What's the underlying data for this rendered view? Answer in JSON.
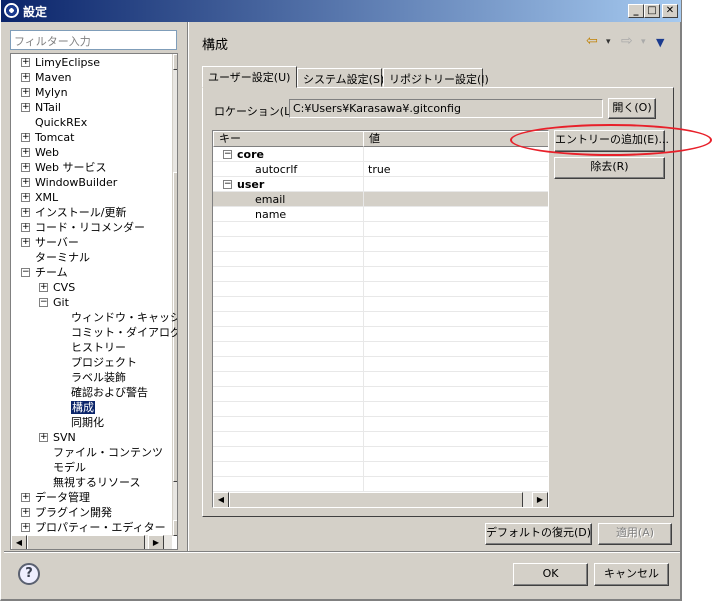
{
  "window": {
    "title": "設定"
  },
  "filter": {
    "placeholder": "フィルター入力"
  },
  "tree": {
    "items": [
      {
        "label": "LimyEclipse",
        "exp": "+"
      },
      {
        "label": "Maven",
        "exp": "+"
      },
      {
        "label": "Mylyn",
        "exp": "+"
      },
      {
        "label": "NTail",
        "exp": "+"
      },
      {
        "label": "QuickREx",
        "exp": ""
      },
      {
        "label": "Tomcat",
        "exp": "+"
      },
      {
        "label": "Web",
        "exp": "+"
      },
      {
        "label": "Web サービス",
        "exp": "+"
      },
      {
        "label": "WindowBuilder",
        "exp": "+"
      },
      {
        "label": "XML",
        "exp": "+"
      },
      {
        "label": "インストール/更新",
        "exp": "+"
      },
      {
        "label": "コード・リコメンダー",
        "exp": "+"
      },
      {
        "label": "サーバー",
        "exp": "+"
      },
      {
        "label": "ターミナル",
        "exp": ""
      },
      {
        "label": "チーム",
        "exp": "−"
      },
      {
        "label": "CVS",
        "exp": "+"
      },
      {
        "label": "Git",
        "exp": "−"
      },
      {
        "label": "ウィンドウ・キャッシュ",
        "exp": ""
      },
      {
        "label": "コミット・ダイアログ",
        "exp": ""
      },
      {
        "label": "ヒストリー",
        "exp": ""
      },
      {
        "label": "プロジェクト",
        "exp": ""
      },
      {
        "label": "ラベル装飾",
        "exp": ""
      },
      {
        "label": "確認および警告",
        "exp": ""
      },
      {
        "label": "構成",
        "exp": ""
      },
      {
        "label": "同期化",
        "exp": ""
      },
      {
        "label": "SVN",
        "exp": "+"
      },
      {
        "label": "ファイル・コンテンツ",
        "exp": ""
      },
      {
        "label": "モデル",
        "exp": ""
      },
      {
        "label": "無視するリソース",
        "exp": ""
      },
      {
        "label": "データ管理",
        "exp": "+"
      },
      {
        "label": "プラグイン開発",
        "exp": "+"
      },
      {
        "label": "プロパティー・エディター",
        "exp": "+"
      }
    ]
  },
  "page": {
    "title": "構成"
  },
  "tabs": [
    "ユーザー設定(U)",
    "システム設定(S)",
    "リポジトリー設定(I)"
  ],
  "location": {
    "label": "ロケーション(L):",
    "value": "C:¥Users¥Karasawa¥.gitconfig",
    "open_button": "開く(O)"
  },
  "table": {
    "headers": [
      "キー",
      "値"
    ],
    "rows": [
      {
        "key": "core",
        "value": "",
        "section": true
      },
      {
        "key": "autocrlf",
        "value": "true",
        "section": false
      },
      {
        "key": "user",
        "value": "",
        "section": true
      },
      {
        "key": "email",
        "value": "",
        "section": false
      },
      {
        "key": "name",
        "value": "",
        "section": false
      }
    ]
  },
  "buttons": {
    "add_entry": "エントリーの追加(E)...",
    "remove": "除去(R)",
    "restore_defaults": "デフォルトの復元(D)",
    "apply": "適用(A)",
    "ok": "OK",
    "cancel": "キャンセル"
  },
  "colors": {
    "highlight": "#e8202a",
    "selection": "#0a246a",
    "titlebar": "#0a246a"
  }
}
